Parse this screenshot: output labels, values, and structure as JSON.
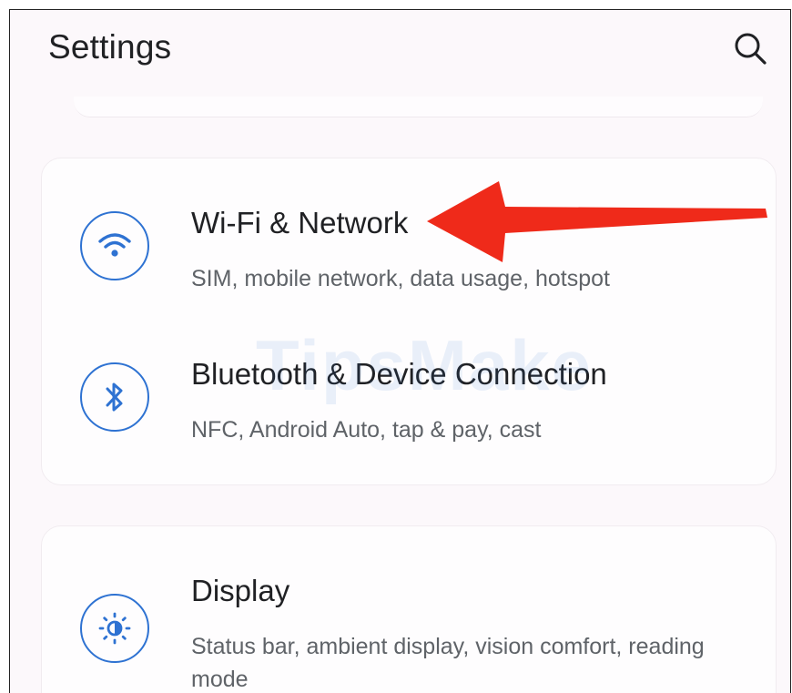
{
  "header": {
    "title": "Settings",
    "search_icon": "search-icon"
  },
  "settings": [
    {
      "icon": "wifi-icon",
      "title": "Wi-Fi & Network",
      "subtitle": "SIM, mobile network, data usage, hotspot"
    },
    {
      "icon": "bluetooth-icon",
      "title": "Bluetooth & Device Connection",
      "subtitle": "NFC, Android Auto, tap & pay, cast"
    },
    {
      "icon": "brightness-icon",
      "title": "Display",
      "subtitle": "Status bar, ambient display, vision comfort, reading mode"
    }
  ],
  "watermark": "TipsMake",
  "colors": {
    "accent": "#2e72d2",
    "annotation_arrow": "#ef2a1a",
    "background": "#fcf8fb"
  }
}
